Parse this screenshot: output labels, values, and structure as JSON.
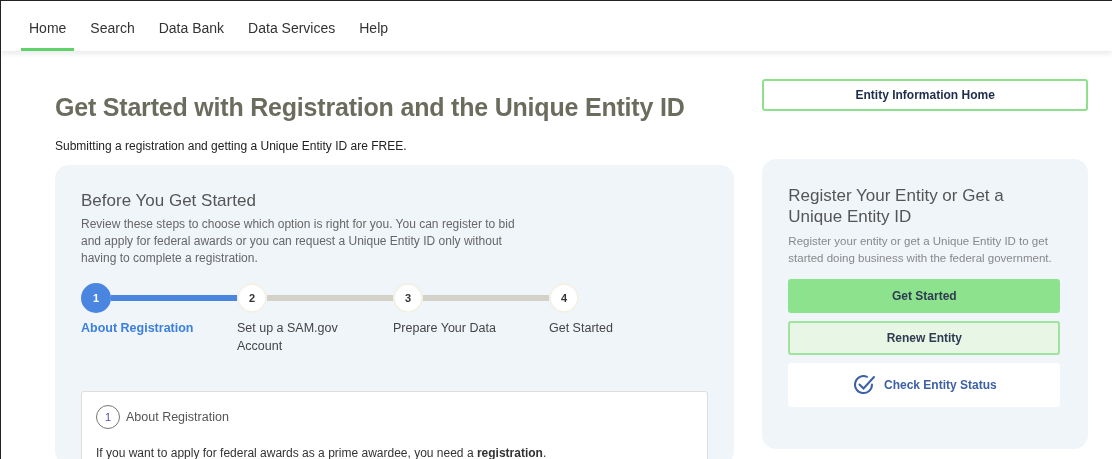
{
  "nav": {
    "items": [
      {
        "label": "Home",
        "selected": true
      },
      {
        "label": "Search",
        "selected": false
      },
      {
        "label": "Data Bank",
        "selected": false
      },
      {
        "label": "Data Services",
        "selected": false
      },
      {
        "label": "Help",
        "selected": false
      }
    ]
  },
  "page": {
    "title": "Get Started with Registration and the Unique Entity ID",
    "subtitle": "Submitting a registration and getting a Unique Entity ID are FREE."
  },
  "before": {
    "heading": "Before You Get Started",
    "description": "Review these steps to choose which option is right for you. You can register to bid and apply for federal awards or you can request a Unique Entity ID only without having to complete a registration.",
    "steps": [
      {
        "number": "1",
        "label": "About Registration",
        "selected": true
      },
      {
        "number": "2",
        "label": "Set up a SAM.gov Account",
        "selected": false
      },
      {
        "number": "3",
        "label": "Prepare Your Data",
        "selected": false
      },
      {
        "number": "4",
        "label": "Get Started",
        "selected": false
      }
    ],
    "panel": {
      "number": "1",
      "title": "About Registration",
      "text": "If you want to apply for federal awards as a prime awardee, you need a **registration**."
    }
  },
  "sidebar": {
    "home_button": "Entity Information Home",
    "card": {
      "heading": "Register Your Entity or Get a Unique Entity ID",
      "description": "Register your entity or get a Unique Entity ID to get started doing business with the federal government.",
      "buttons": [
        {
          "label": "Get Started",
          "kind": "primary"
        },
        {
          "label": "Renew Entity",
          "kind": "secondary"
        },
        {
          "label": "Check Entity Status",
          "kind": "icon"
        }
      ]
    }
  }
}
